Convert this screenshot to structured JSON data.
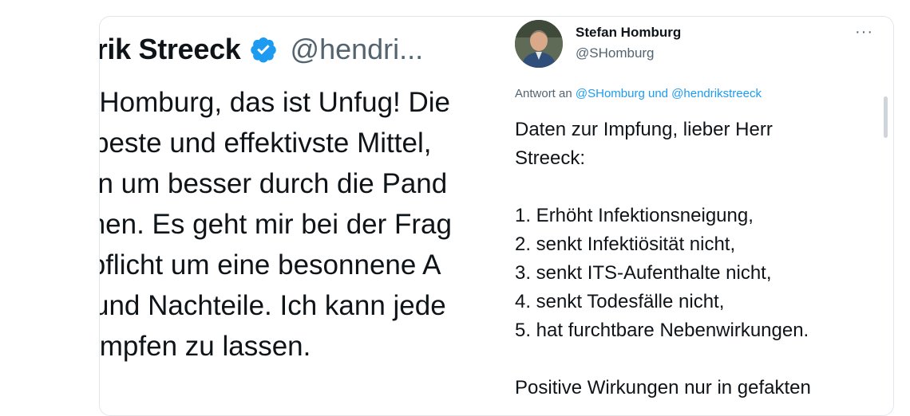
{
  "left_tweet": {
    "name": "drik Streeck",
    "handle": "@hendri...",
    "lines": [
      "r Homburg, das ist Unfug! Die",
      "beste und effektivste Mittel,",
      "en um besser durch die Pand",
      "men. Es geht mir bei der Frag",
      "fpflicht um eine besonnene A",
      "und Nachteile. Ich kann jede",
      "impfen zu lassen."
    ]
  },
  "right_tweet": {
    "name": "Stefan Homburg",
    "handle": "@SHomburg",
    "more": "···",
    "reply_prefix": "Antwort an",
    "reply_mentions": "@SHomburg und @hendrikstreeck",
    "intro": [
      "Daten zur Impfung, lieber Herr",
      "Streeck:"
    ],
    "list": [
      "1. Erhöht Infektionsneigung,",
      "2. senkt Infektiösität nicht,",
      "3. senkt ITS-Aufenthalte nicht,",
      "4. senkt Todesfälle nicht,",
      "5. hat furchtbare Nebenwirkungen."
    ],
    "outro": "Positive Wirkungen nur in gefakten"
  },
  "colors": {
    "accent": "#1d9bf0",
    "muted": "#536471",
    "text": "#0f1419"
  }
}
